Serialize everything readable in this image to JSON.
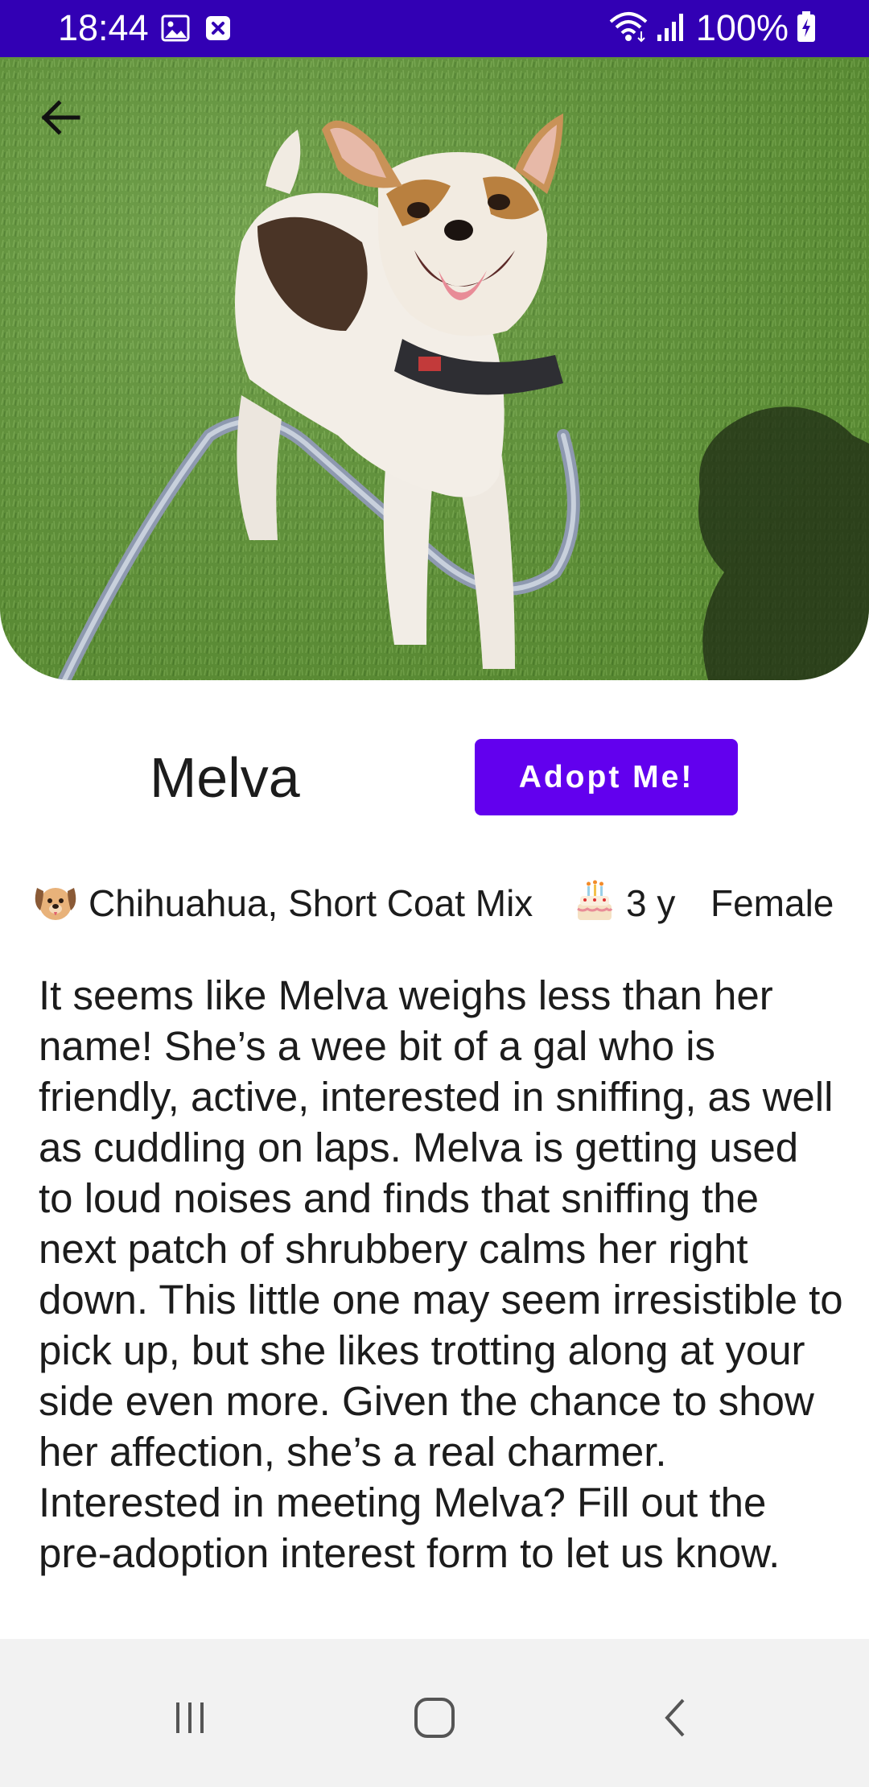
{
  "status_bar": {
    "time": "18:44",
    "battery": "100%",
    "icons": [
      "gallery-icon",
      "app-notification-icon",
      "wifi-icon",
      "signal-icon",
      "battery-charging-icon"
    ],
    "background_color": "#3200b4"
  },
  "hero": {
    "image_subject": "dog photo",
    "back_icon": "arrow-left-icon"
  },
  "pet": {
    "name": "Melva",
    "adopt_label": "Adopt Me!",
    "breed": "Chihuahua, Short Coat Mix",
    "age": "3 y",
    "gender": "Female",
    "breed_icon": "dog-face-icon",
    "age_icon": "birthday-cake-icon",
    "description": "It seems like Melva weighs less than her name! She’s a wee bit of a gal who is friendly, active, interested in sniffing, as well as cuddling on laps. Melva is getting used to loud noises and finds that sniffing the next patch of shrubbery calms her right down. This little one may seem irresistible to pick up, but she likes trotting along at your side even more. Given the chance to show her affection, she’s a real charmer. Interested in meeting Melva? Fill out the pre-adoption interest form to let us know."
  },
  "colors": {
    "accent": "#6200ee",
    "nav_background": "#f2f2f2"
  },
  "nav_bar": {
    "buttons": [
      "recent-apps-icon",
      "home-icon",
      "back-chevron-icon"
    ]
  }
}
